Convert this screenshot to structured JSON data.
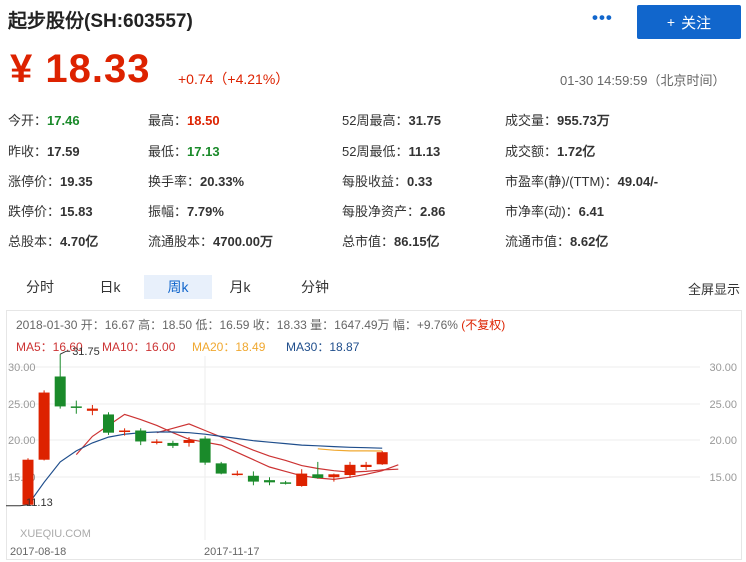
{
  "header": {
    "stock_title": "起步股份(SH:603557)",
    "more_label": "•••",
    "follow_plus": "+",
    "follow_label": "关注"
  },
  "quote": {
    "price": "¥ 18.33",
    "change": "+0.74（+4.21%）",
    "time": "01-30 14:59:59（北京时间）"
  },
  "stats": [
    {
      "label": "今开：",
      "value": "17.46",
      "tone": "down"
    },
    {
      "label": "最高：",
      "value": "18.50",
      "tone": "up"
    },
    {
      "label": "52周最高：",
      "value": "31.75",
      "tone": ""
    },
    {
      "label": "成交量：",
      "value": "955.73万",
      "tone": ""
    },
    {
      "label": "昨收：",
      "value": "17.59",
      "tone": ""
    },
    {
      "label": "最低：",
      "value": "17.13",
      "tone": "down"
    },
    {
      "label": "52周最低：",
      "value": "11.13",
      "tone": ""
    },
    {
      "label": "成交额：",
      "value": "1.72亿",
      "tone": ""
    },
    {
      "label": "涨停价：",
      "value": "19.35",
      "tone": ""
    },
    {
      "label": "换手率：",
      "value": "20.33%",
      "tone": ""
    },
    {
      "label": "每股收益：",
      "value": "0.33",
      "tone": ""
    },
    {
      "label": "市盈率(静)/(TTM)：",
      "value": "49.04/-",
      "tone": ""
    },
    {
      "label": "跌停价：",
      "value": "15.83",
      "tone": ""
    },
    {
      "label": "振幅：",
      "value": "7.79%",
      "tone": ""
    },
    {
      "label": "每股净资产：",
      "value": "2.86",
      "tone": ""
    },
    {
      "label": "市净率(动)：",
      "value": "6.41",
      "tone": ""
    },
    {
      "label": "总股本：",
      "value": "4.70亿",
      "tone": ""
    },
    {
      "label": "流通股本：",
      "value": "4700.00万",
      "tone": ""
    },
    {
      "label": "总市值：",
      "value": "86.15亿",
      "tone": ""
    },
    {
      "label": "流通市值：",
      "value": "8.62亿",
      "tone": ""
    }
  ],
  "tabs": [
    "分时",
    "日k",
    "周k",
    "月k",
    "分钟"
  ],
  "active_tab": "周k",
  "fullscreen_label": "全屏显示",
  "chart_info": {
    "text": "2018-01-30 开：16.67 高：18.50 低：16.59 收：18.33 量：1647.49万 幅：+9.76%",
    "fq": "(不复权)"
  },
  "ma_labels": [
    {
      "text": "MA5：16.60",
      "color": "#cc3333"
    },
    {
      "text": "MA10：16.00",
      "color": "#cc3333"
    },
    {
      "text": "MA20：18.49",
      "color": "#f0a830"
    },
    {
      "text": "MA30：18.87",
      "color": "#1f4e8c"
    }
  ],
  "colors": {
    "up": "#dd2200",
    "down": "#1a8a2a",
    "accent": "#1166cc"
  },
  "chart_data": {
    "type": "candlestick",
    "y_ticks": [
      "30.00",
      "25.00",
      "20.00",
      "15.00"
    ],
    "ylim": [
      10,
      31.75
    ],
    "x_labels": [
      "2017-08-18",
      "2017-11-17"
    ],
    "watermark": "XUEQIU.COM",
    "high_label": "31.75",
    "low_label": "11.13",
    "candles": [
      {
        "o": 11.13,
        "h": 17.5,
        "l": 11.13,
        "c": 17.3
      },
      {
        "o": 17.3,
        "h": 26.8,
        "l": 17.2,
        "c": 26.5
      },
      {
        "o": 28.7,
        "h": 31.75,
        "l": 24.3,
        "c": 24.6
      },
      {
        "o": 24.6,
        "h": 25.4,
        "l": 23.6,
        "c": 24.4
      },
      {
        "o": 24.0,
        "h": 24.8,
        "l": 23.4,
        "c": 24.3
      },
      {
        "o": 23.5,
        "h": 23.8,
        "l": 20.7,
        "c": 21.0
      },
      {
        "o": 21.2,
        "h": 21.6,
        "l": 20.6,
        "c": 21.3
      },
      {
        "o": 21.3,
        "h": 21.6,
        "l": 19.3,
        "c": 19.8
      },
      {
        "o": 19.7,
        "h": 20.1,
        "l": 19.4,
        "c": 19.8
      },
      {
        "o": 19.6,
        "h": 19.9,
        "l": 18.9,
        "c": 19.2
      },
      {
        "o": 19.6,
        "h": 20.4,
        "l": 19.1,
        "c": 20.0
      },
      {
        "o": 20.2,
        "h": 20.5,
        "l": 16.6,
        "c": 16.9
      },
      {
        "o": 16.8,
        "h": 17.0,
        "l": 15.3,
        "c": 15.4
      },
      {
        "o": 15.4,
        "h": 15.8,
        "l": 15.1,
        "c": 15.4
      },
      {
        "o": 15.1,
        "h": 15.7,
        "l": 13.8,
        "c": 14.3
      },
      {
        "o": 14.5,
        "h": 14.9,
        "l": 13.8,
        "c": 14.2
      },
      {
        "o": 14.2,
        "h": 14.4,
        "l": 13.9,
        "c": 14.0
      },
      {
        "o": 13.7,
        "h": 16.0,
        "l": 13.6,
        "c": 15.4
      },
      {
        "o": 15.3,
        "h": 17.0,
        "l": 14.7,
        "c": 14.8
      },
      {
        "o": 14.9,
        "h": 15.4,
        "l": 14.3,
        "c": 15.3
      },
      {
        "o": 15.2,
        "h": 17.0,
        "l": 14.8,
        "c": 16.6
      },
      {
        "o": 16.3,
        "h": 17.0,
        "l": 15.9,
        "c": 16.6
      },
      {
        "o": 16.67,
        "h": 18.5,
        "l": 16.59,
        "c": 18.33
      }
    ],
    "ma_series": [
      {
        "key": "MA5",
        "color": "#cc3333",
        "start": 3,
        "values": [
          18.0,
          20.5,
          22.0,
          23.5,
          22.8,
          22.0,
          21.0,
          20.1,
          19.7,
          19.3,
          18.3,
          17.3,
          16.3,
          15.7,
          15.1,
          14.8,
          14.6,
          14.9,
          15.3,
          15.8,
          16.6
        ]
      },
      {
        "key": "MA10",
        "color": "#cc3333",
        "start": 8,
        "values": [
          21.0,
          21.6,
          22.2,
          21.3,
          20.4,
          19.5,
          18.6,
          17.8,
          17.2,
          16.5,
          16.1,
          15.8,
          15.6,
          15.7,
          15.9,
          16.0
        ]
      },
      {
        "key": "MA20",
        "color": "#f0a830",
        "start": 18,
        "values": [
          18.8,
          18.6,
          18.5,
          18.5,
          18.49
        ]
      },
      {
        "key": "MA30",
        "color": "#1f4e8c",
        "start": 0,
        "values": [
          11.13,
          14.2,
          17.0,
          18.5,
          19.6,
          20.4,
          20.8,
          21.0,
          21.1,
          21.1,
          21.0,
          20.8,
          20.5,
          20.2,
          19.9,
          19.7,
          19.5,
          19.3,
          19.2,
          19.1,
          19.0,
          18.95,
          18.87
        ]
      }
    ]
  }
}
